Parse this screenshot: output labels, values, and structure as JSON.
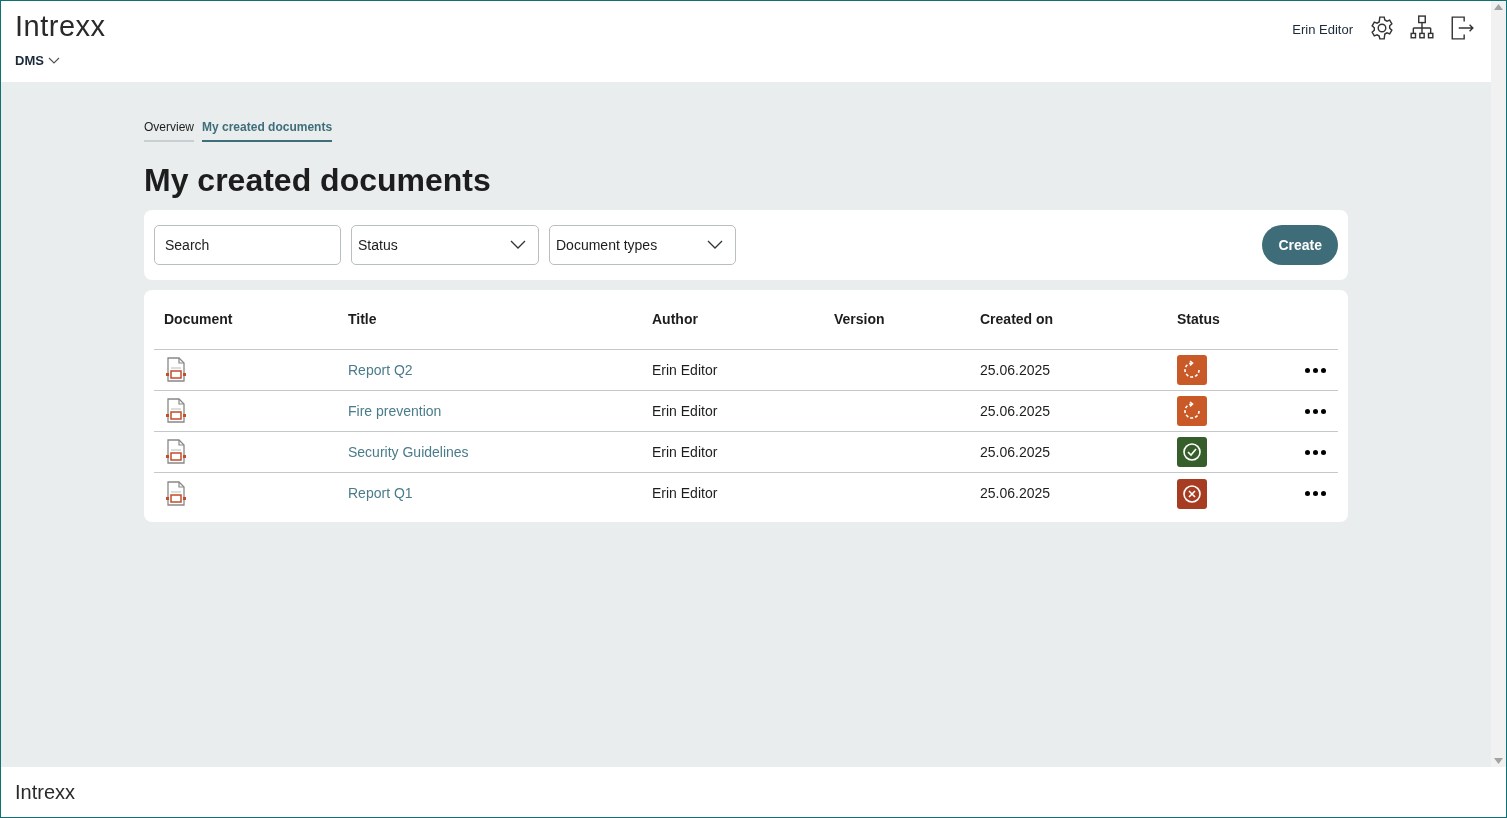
{
  "header": {
    "logo": "Intrexx",
    "app_menu": "DMS",
    "user": "Erin Editor"
  },
  "tabs": [
    {
      "label": "Overview",
      "selected": false
    },
    {
      "label": "My created documents",
      "selected": true
    }
  ],
  "page_title": "My created documents",
  "filters": {
    "search": {
      "placeholder": "Search"
    },
    "status": {
      "label": "Status"
    },
    "document_types": {
      "label": "Document types"
    },
    "create_button": "Create"
  },
  "table": {
    "columns": [
      "Document",
      "Title",
      "Author",
      "Version",
      "Created on",
      "Status"
    ],
    "rows": [
      {
        "title": "Report Q2",
        "author": "Erin Editor",
        "created_on": "25.06.2025",
        "status": {
          "kind": "pending",
          "color": "#c95a27"
        }
      },
      {
        "title": "Fire prevention",
        "author": "Erin Editor",
        "created_on": "25.06.2025",
        "status": {
          "kind": "pending",
          "color": "#c95a27"
        }
      },
      {
        "title": "Security Guidelines",
        "author": "Erin Editor",
        "created_on": "25.06.2025",
        "status": {
          "kind": "approved",
          "color": "#365e2a"
        }
      },
      {
        "title": "Report Q1",
        "author": "Erin Editor",
        "created_on": "25.06.2025",
        "status": {
          "kind": "rejected",
          "color": "#a63d22"
        }
      }
    ]
  },
  "footer": {
    "logo": "Intrexx"
  }
}
